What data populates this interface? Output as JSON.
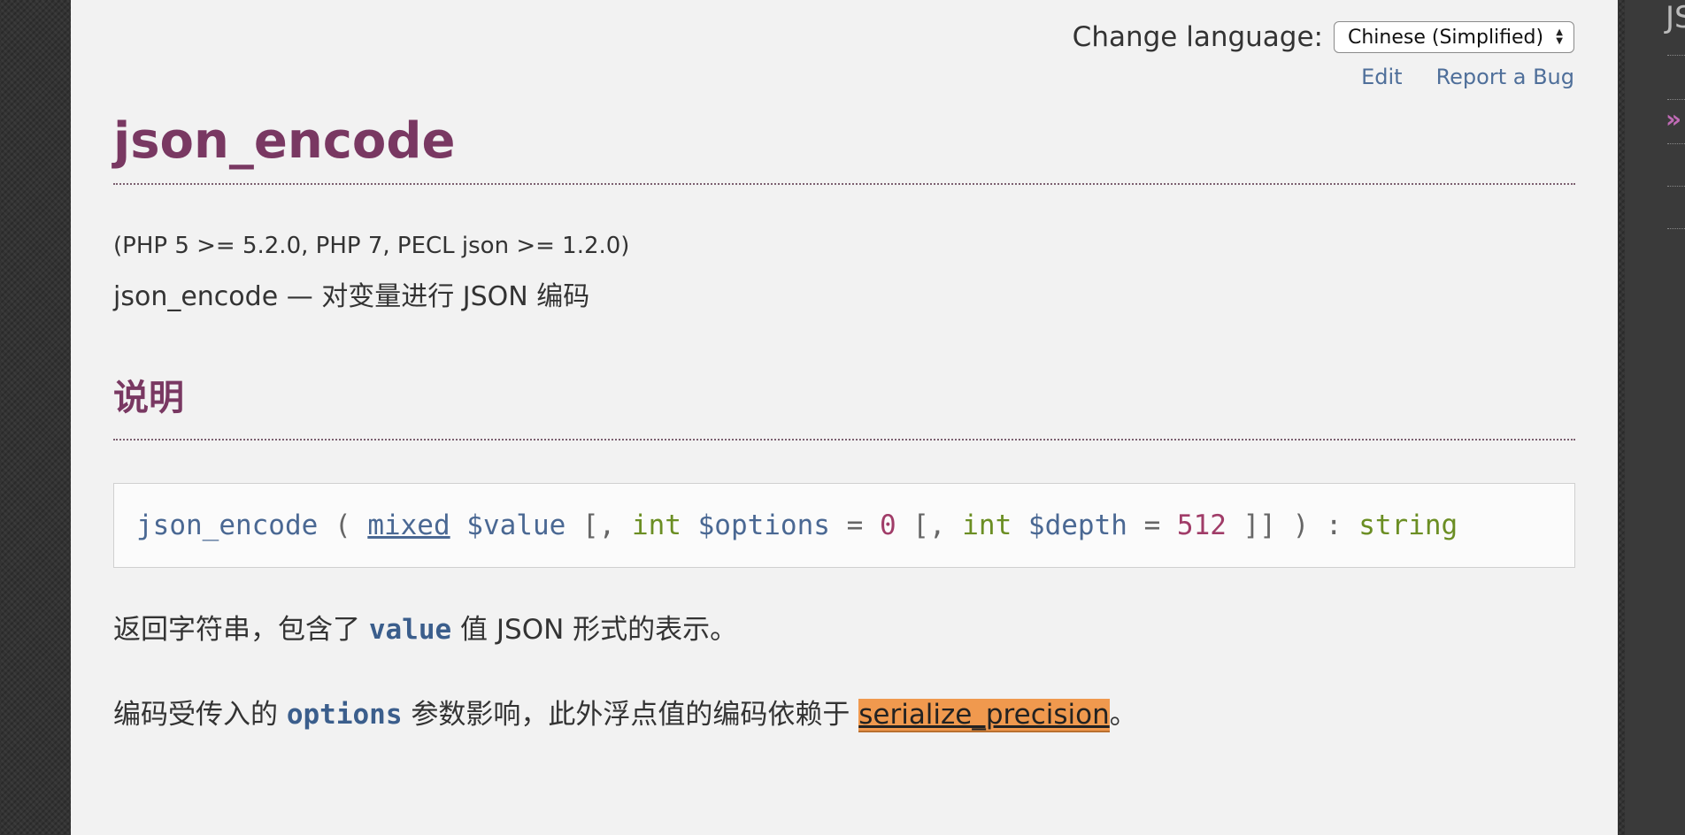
{
  "header": {
    "change_language_label": "Change language:",
    "language_selected": "Chinese (Simplified)",
    "edit_link": "Edit",
    "report_bug_link": "Report a Bug"
  },
  "refentry": {
    "title": "json_encode",
    "version_info": "(PHP 5 >= 5.2.0, PHP 7, PECL json >= 1.2.0)",
    "refname": "json_encode — 对变量进行 JSON 编码"
  },
  "description": {
    "heading": "说明",
    "synopsis": {
      "method_name": "json_encode",
      "open_paren": " ( ",
      "param1_type": "mixed",
      "param1_var": " $value",
      "bracket1": " [, ",
      "param2_type": "int",
      "param2_var": " $options",
      "eq1": " = ",
      "param2_default": "0",
      "bracket2": " [, ",
      "param3_type": "int",
      "param3_var": " $depth",
      "eq2": " = ",
      "param3_default": "512",
      "close": " ]] ) : ",
      "return_type": "string"
    },
    "para1": {
      "before": "返回字符串，包含了 ",
      "code": "value",
      "after": " 值 JSON 形式的表示。"
    },
    "para2": {
      "before": "编码受传入的 ",
      "code": "options",
      "middle": " 参数影响，此外浮点值的编码依赖于 ",
      "highlight": "serialize_precision",
      "after": "。"
    }
  },
  "sidebar": {
    "title_fragment": "JS",
    "marker": "»"
  }
}
